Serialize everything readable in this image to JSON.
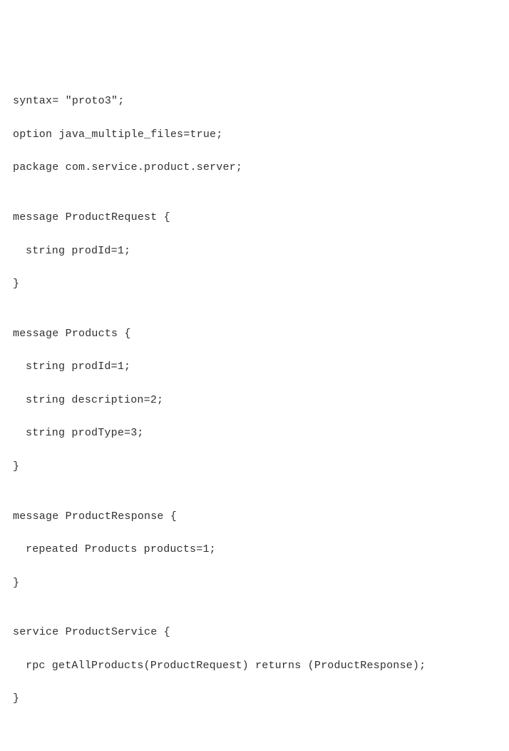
{
  "code": {
    "l1": "syntax= \"proto3\";",
    "l2": "option java_multiple_files=true;",
    "l3": "package com.service.product.server;",
    "l4": "",
    "l5": "message ProductRequest {",
    "l6": "string prodId=1;",
    "l7": "}",
    "l8": "",
    "l9": "message Products {",
    "l10": "string prodId=1;",
    "l11": "string description=2;",
    "l12": "string prodType=3;",
    "l13": "}",
    "l14": "",
    "l15": "message ProductResponse {",
    "l16": "repeated Products products=1;",
    "l17": "}",
    "l18": "",
    "l19": "service ProductService {",
    "l20": "rpc getAllProducts(ProductRequest) returns (ProductResponse);",
    "l21": "}"
  }
}
